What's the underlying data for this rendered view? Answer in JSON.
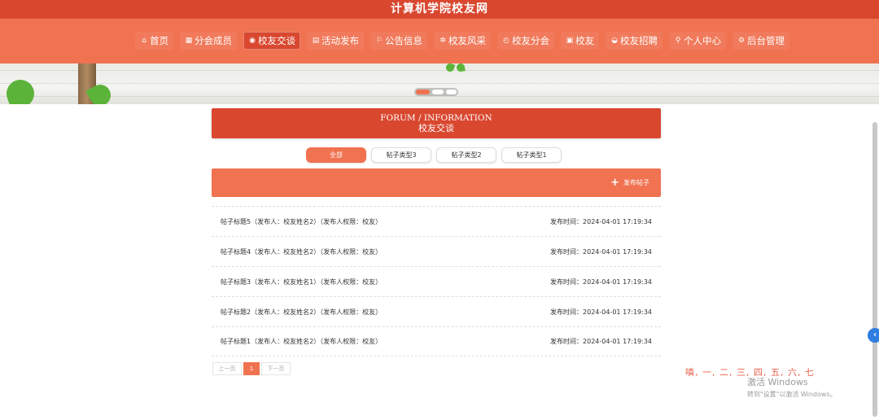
{
  "header": {
    "title": "计算机学院校友网"
  },
  "nav": [
    {
      "icon": "⌂",
      "icon_name": "home-icon",
      "label": "首页"
    },
    {
      "icon": "▦",
      "icon_name": "grid-icon",
      "label": "分会成员"
    },
    {
      "icon": "◉",
      "icon_name": "globe-icon",
      "label": "校友交谈",
      "active": true
    },
    {
      "icon": "▤",
      "icon_name": "calendar-icon",
      "label": "活动发布"
    },
    {
      "icon": "⚐",
      "icon_name": "flag-icon",
      "label": "公告信息"
    },
    {
      "icon": "✲",
      "icon_name": "flower-icon",
      "label": "校友风采"
    },
    {
      "icon": "◴",
      "icon_name": "clock-icon",
      "label": "校友分会"
    },
    {
      "icon": "▣",
      "icon_name": "card-icon",
      "label": "校友"
    },
    {
      "icon": "◒",
      "icon_name": "briefcase-icon",
      "label": "校友招聘"
    },
    {
      "icon": "⚲",
      "icon_name": "user-icon",
      "label": "个人中心"
    },
    {
      "icon": "⚙",
      "icon_name": "link-icon",
      "label": "后台管理"
    }
  ],
  "forum": {
    "title_en": "FORUM / INFORMATION",
    "title_cn": "校友交谈"
  },
  "filters": [
    {
      "label": "全部",
      "active": true
    },
    {
      "label": "帖子类型3"
    },
    {
      "label": "帖子类型2"
    },
    {
      "label": "帖子类型1"
    }
  ],
  "actions": {
    "publish_label": "发布帖子",
    "publish_icon": "+"
  },
  "posts": [
    {
      "title": "帖子标题5（发布人：校友姓名2）（发布人权限：校友）",
      "time": "发布时间：2024-04-01 17:19:34"
    },
    {
      "title": "帖子标题4（发布人：校友姓名2）（发布人权限：校友）",
      "time": "发布时间：2024-04-01 17:19:34"
    },
    {
      "title": "帖子标题3（发布人：校友姓名1）（发布人权限：校友）",
      "time": "发布时间：2024-04-01 17:19:34"
    },
    {
      "title": "帖子标题2（发布人：校友姓名2）（发布人权限：校友）",
      "time": "发布时间：2024-04-01 17:19:34"
    },
    {
      "title": "帖子标题1（发布人：校友姓名2）（发布人权限：校友）",
      "time": "发布时间：2024-04-01 17:19:34"
    }
  ],
  "pagination": {
    "prev": "上一页",
    "current": "1",
    "next": "下一页"
  },
  "ime": {
    "candidates": "嗔, 一, 二, 三, 四, 五, 六, 七"
  },
  "watermark": {
    "title": "激活 Windows",
    "subtitle": "转到\"设置\"以激活 Windows。"
  },
  "colors": {
    "primary": "#d9472f",
    "accent": "#f07251",
    "side_button": "#2f7de1"
  }
}
